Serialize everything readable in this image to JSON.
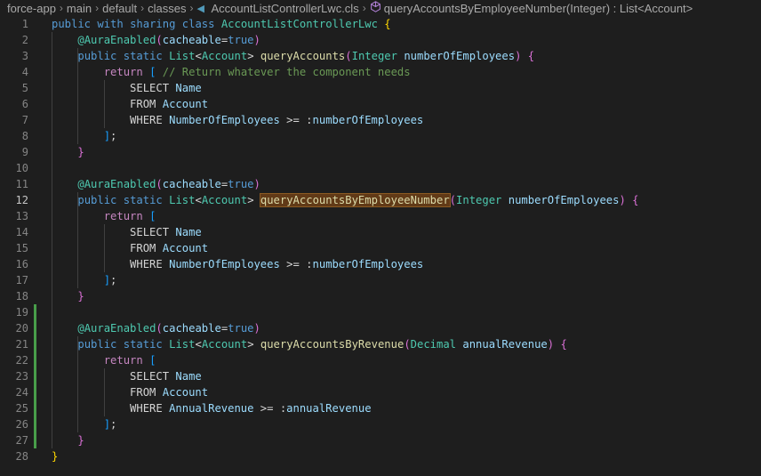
{
  "breadcrumb": {
    "items": [
      "force-app",
      "main",
      "default",
      "classes",
      "AccountListControllerLwc.cls",
      "queryAccountsByEmployeeNumber(Integer) : List<Account>"
    ],
    "separator": "›",
    "file_icon": "apex-file-icon",
    "symbol_icon": "method-cube-icon"
  },
  "editor": {
    "active_line": 12,
    "highlighted_word": "queryAccountsByEmployeeNumber",
    "modified_lines": [
      19,
      20,
      21,
      22,
      23,
      24,
      25,
      26,
      27
    ],
    "lines": [
      [
        [
          "kw",
          "public"
        ],
        [
          "pl",
          " "
        ],
        [
          "kw",
          "with"
        ],
        [
          "pl",
          " "
        ],
        [
          "kw",
          "sharing"
        ],
        [
          "pl",
          " "
        ],
        [
          "kw",
          "class"
        ],
        [
          "pl",
          " "
        ],
        [
          "type",
          "AccountListControllerLwc"
        ],
        [
          "pl",
          " "
        ],
        [
          "br",
          "{"
        ]
      ],
      [
        [
          "pl",
          "    "
        ],
        [
          "ann",
          "@AuraEnabled"
        ],
        [
          "br2",
          "("
        ],
        [
          "var",
          "cacheable"
        ],
        [
          "pl",
          "="
        ],
        [
          "kw",
          "true"
        ],
        [
          "br2",
          ")"
        ]
      ],
      [
        [
          "pl",
          "    "
        ],
        [
          "kw",
          "public"
        ],
        [
          "pl",
          " "
        ],
        [
          "kw",
          "static"
        ],
        [
          "pl",
          " "
        ],
        [
          "type",
          "List"
        ],
        [
          "pl",
          "<"
        ],
        [
          "type",
          "Account"
        ],
        [
          "pl",
          "> "
        ],
        [
          "fn",
          "queryAccounts"
        ],
        [
          "br2",
          "("
        ],
        [
          "type",
          "Integer"
        ],
        [
          "pl",
          " "
        ],
        [
          "var",
          "numberOfEmployees"
        ],
        [
          "br2",
          ")"
        ],
        [
          "pl",
          " "
        ],
        [
          "br2",
          "{"
        ]
      ],
      [
        [
          "pl",
          "        "
        ],
        [
          "ctrl",
          "return"
        ],
        [
          "pl",
          " "
        ],
        [
          "br3",
          "["
        ],
        [
          "pl",
          " "
        ],
        [
          "cm",
          "// Return whatever the component needs"
        ]
      ],
      [
        [
          "pl",
          "            SELECT "
        ],
        [
          "var",
          "Name"
        ]
      ],
      [
        [
          "pl",
          "            FROM "
        ],
        [
          "var",
          "Account"
        ]
      ],
      [
        [
          "pl",
          "            WHERE "
        ],
        [
          "var",
          "NumberOfEmployees"
        ],
        [
          "pl",
          " >= :"
        ],
        [
          "var",
          "numberOfEmployees"
        ]
      ],
      [
        [
          "pl",
          "        "
        ],
        [
          "br3",
          "]"
        ],
        [
          "pl",
          ";"
        ]
      ],
      [
        [
          "pl",
          "    "
        ],
        [
          "br2",
          "}"
        ]
      ],
      [
        [
          "pl",
          ""
        ]
      ],
      [
        [
          "pl",
          "    "
        ],
        [
          "ann",
          "@AuraEnabled"
        ],
        [
          "br2",
          "("
        ],
        [
          "var",
          "cacheable"
        ],
        [
          "pl",
          "="
        ],
        [
          "kw",
          "true"
        ],
        [
          "br2",
          ")"
        ]
      ],
      [
        [
          "pl",
          "    "
        ],
        [
          "kw",
          "public"
        ],
        [
          "pl",
          " "
        ],
        [
          "kw",
          "static"
        ],
        [
          "pl",
          " "
        ],
        [
          "type",
          "List"
        ],
        [
          "pl",
          "<"
        ],
        [
          "type",
          "Account"
        ],
        [
          "pl",
          "> "
        ],
        [
          "fnhl",
          "queryAccountsByEmployeeNumber"
        ],
        [
          "br2",
          "("
        ],
        [
          "type",
          "Integer"
        ],
        [
          "pl",
          " "
        ],
        [
          "var",
          "numberOfEmployees"
        ],
        [
          "br2",
          ")"
        ],
        [
          "pl",
          " "
        ],
        [
          "br2",
          "{"
        ]
      ],
      [
        [
          "pl",
          "        "
        ],
        [
          "ctrl",
          "return"
        ],
        [
          "pl",
          " "
        ],
        [
          "br3",
          "["
        ]
      ],
      [
        [
          "pl",
          "            SELECT "
        ],
        [
          "var",
          "Name"
        ]
      ],
      [
        [
          "pl",
          "            FROM "
        ],
        [
          "var",
          "Account"
        ]
      ],
      [
        [
          "pl",
          "            WHERE "
        ],
        [
          "var",
          "NumberOfEmployees"
        ],
        [
          "pl",
          " >= :"
        ],
        [
          "var",
          "numberOfEmployees"
        ]
      ],
      [
        [
          "pl",
          "        "
        ],
        [
          "br3",
          "]"
        ],
        [
          "pl",
          ";"
        ]
      ],
      [
        [
          "pl",
          "    "
        ],
        [
          "br2",
          "}"
        ]
      ],
      [
        [
          "pl",
          ""
        ]
      ],
      [
        [
          "pl",
          "    "
        ],
        [
          "ann",
          "@AuraEnabled"
        ],
        [
          "br2",
          "("
        ],
        [
          "var",
          "cacheable"
        ],
        [
          "pl",
          "="
        ],
        [
          "kw",
          "true"
        ],
        [
          "br2",
          ")"
        ]
      ],
      [
        [
          "pl",
          "    "
        ],
        [
          "kw",
          "public"
        ],
        [
          "pl",
          " "
        ],
        [
          "kw",
          "static"
        ],
        [
          "pl",
          " "
        ],
        [
          "type",
          "List"
        ],
        [
          "pl",
          "<"
        ],
        [
          "type",
          "Account"
        ],
        [
          "pl",
          "> "
        ],
        [
          "fn",
          "queryAccountsByRevenue"
        ],
        [
          "br2",
          "("
        ],
        [
          "type",
          "Decimal"
        ],
        [
          "pl",
          " "
        ],
        [
          "var",
          "annualRevenue"
        ],
        [
          "br2",
          ")"
        ],
        [
          "pl",
          " "
        ],
        [
          "br2",
          "{"
        ]
      ],
      [
        [
          "pl",
          "        "
        ],
        [
          "ctrl",
          "return"
        ],
        [
          "pl",
          " "
        ],
        [
          "br3",
          "["
        ]
      ],
      [
        [
          "pl",
          "            SELECT "
        ],
        [
          "var",
          "Name"
        ]
      ],
      [
        [
          "pl",
          "            FROM "
        ],
        [
          "var",
          "Account"
        ]
      ],
      [
        [
          "pl",
          "            WHERE "
        ],
        [
          "var",
          "AnnualRevenue"
        ],
        [
          "pl",
          " >= :"
        ],
        [
          "var",
          "annualRevenue"
        ]
      ],
      [
        [
          "pl",
          "        "
        ],
        [
          "br3",
          "]"
        ],
        [
          "pl",
          ";"
        ]
      ],
      [
        [
          "pl",
          "    "
        ],
        [
          "br2",
          "}"
        ]
      ],
      [
        [
          "br",
          "}"
        ]
      ]
    ]
  }
}
